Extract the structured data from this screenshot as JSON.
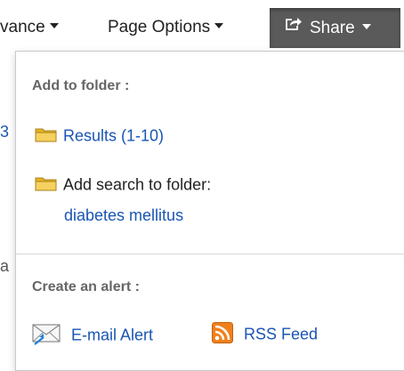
{
  "menu": {
    "advanced_label": "vance",
    "page_options_label": "Page Options",
    "share_label": "Share"
  },
  "dropdown": {
    "folder_section_title": "Add to folder :",
    "results_link": "Results (1-10)",
    "add_search_label": "Add search to folder:",
    "search_term_link": "diabetes mellitus",
    "alert_section_title": "Create an alert :",
    "email_alert_label": "E-mail Alert",
    "rss_feed_label": "RSS Feed"
  },
  "background": {
    "fragment_1": "3",
    "fragment_2": "a"
  },
  "colors": {
    "link": "#1a55b3",
    "share_button_bg": "#5a5a5a",
    "rss_orange": "#f0801c"
  },
  "icons": {
    "folder": "folder-icon",
    "share": "share-arrow-icon",
    "email": "email-alert-icon",
    "rss": "rss-icon"
  }
}
